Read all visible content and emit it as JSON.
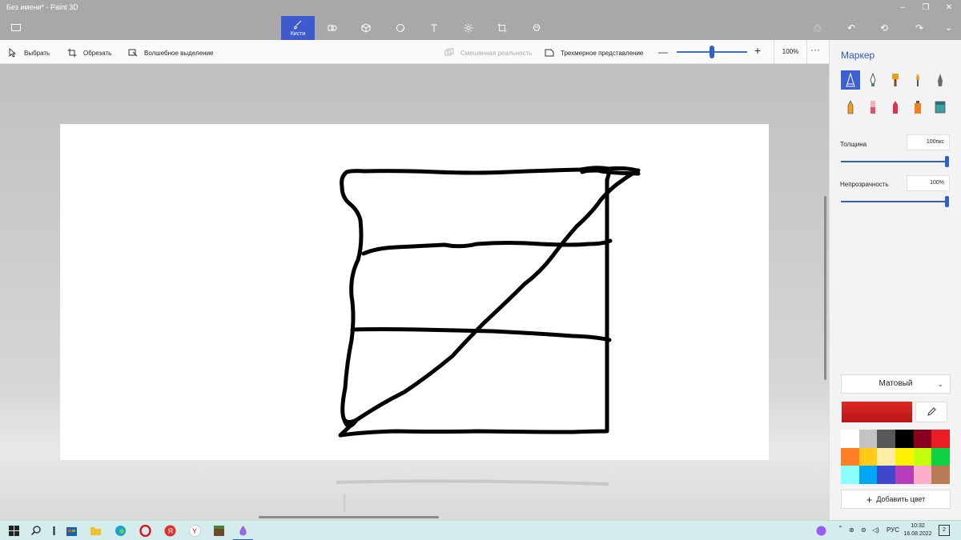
{
  "window": {
    "title": "Без имени* - Paint 3D",
    "tabs": [
      {
        "label": "Кисти",
        "icon": "brush-icon",
        "active": true
      },
      {
        "label": "",
        "icon": "2d-shapes-icon"
      },
      {
        "label": "",
        "icon": "3d-shapes-icon"
      },
      {
        "label": "",
        "icon": "stickers-icon"
      },
      {
        "label": "",
        "icon": "text-icon"
      },
      {
        "label": "",
        "icon": "effects-icon"
      },
      {
        "label": "",
        "icon": "canvas-icon"
      },
      {
        "label": "",
        "icon": "3d-library-icon"
      }
    ]
  },
  "commandbar": {
    "select": "Выбрать",
    "crop": "Обрезать",
    "magic_select": "Волшебное выделение",
    "mixed_reality": "Смешанная реальность",
    "view_3d": "Трехмерное представление",
    "zoom": "100%",
    "zoom_level": 0.5,
    "more": "···"
  },
  "panel": {
    "title": "Маркер",
    "brushes": [
      {
        "name": "marker",
        "color": "#ffffff",
        "selected": true
      },
      {
        "name": "calligraphy-pen",
        "color": "#3a8f5a"
      },
      {
        "name": "oil-brush",
        "color": "#e8a018"
      },
      {
        "name": "watercolor",
        "color": "#e8a018"
      },
      {
        "name": "pixel-pen",
        "color": "#4a4a4a"
      },
      {
        "name": "pencil",
        "color": "#f0a020"
      },
      {
        "name": "eraser",
        "color": "#e05070"
      },
      {
        "name": "crayon",
        "color": "#e0304a"
      },
      {
        "name": "spray-can",
        "color": "#f08020"
      },
      {
        "name": "fill",
        "color": "#3aa0a0"
      }
    ],
    "thickness_label": "Толщина",
    "thickness_value": "100пкс",
    "opacity_label": "Непрозрачность",
    "opacity_value": "100%",
    "finish": "Матовый",
    "current_color": "#e02828",
    "add_color": "Добавить цвет",
    "palette": [
      "#ffffff",
      "#c3c3c3",
      "#585858",
      "#000000",
      "#88001b",
      "#ec1c24",
      "#ff7f27",
      "#ffca18",
      "#fdeca6",
      "#fff200",
      "#c4ff0e",
      "#0ed145",
      "#8cfffb",
      "#00a8f3",
      "#3f48cc",
      "#b83dba",
      "#ffaec8",
      "#b97a56"
    ]
  },
  "taskbar": {
    "lang": "РУС",
    "time": "10:32",
    "date": "16.08.2022",
    "notifications": "2"
  }
}
